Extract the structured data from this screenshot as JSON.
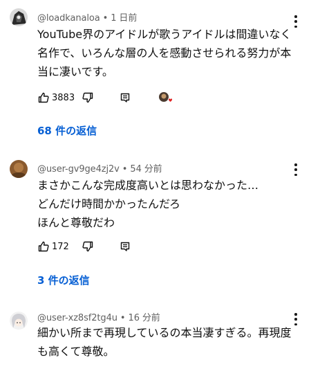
{
  "comments": [
    {
      "handle": "@loadkanaloa",
      "time": " • 1 日前",
      "lines": [
        "YouTube界のアイドルが歌うアイドルは間違いなく",
        "名作で、いろんな層の人を感動させられる努力が本",
        "当に凄いです。"
      ],
      "likes": "3883",
      "replies_label": "68 件の返信",
      "has_creator_heart": true,
      "avatar_icon": "avatar-dark-figure"
    },
    {
      "handle": "@user-gv9ge4zj2v",
      "time": " • 54 分前",
      "lines": [
        "まさかこんな完成度高いとは思わなかった…",
        "どんだけ時間かかったんだろ",
        "ほんと尊敬だわ"
      ],
      "likes": "172",
      "replies_label": "3 件の返信",
      "avatar_icon": "avatar-brown"
    },
    {
      "handle": "@user-xz8sf2tg4u",
      "time": " • 16 分前",
      "lines": [
        "細かい所まで再現しているの本当凄すぎる。再現度",
        "も高くて尊敬。"
      ],
      "avatar_icon": "avatar-anime-silver"
    }
  ],
  "colors": {
    "link": "#065fd4",
    "meta": "#606060",
    "text": "#0f0f0f",
    "heart": "#e02424"
  }
}
